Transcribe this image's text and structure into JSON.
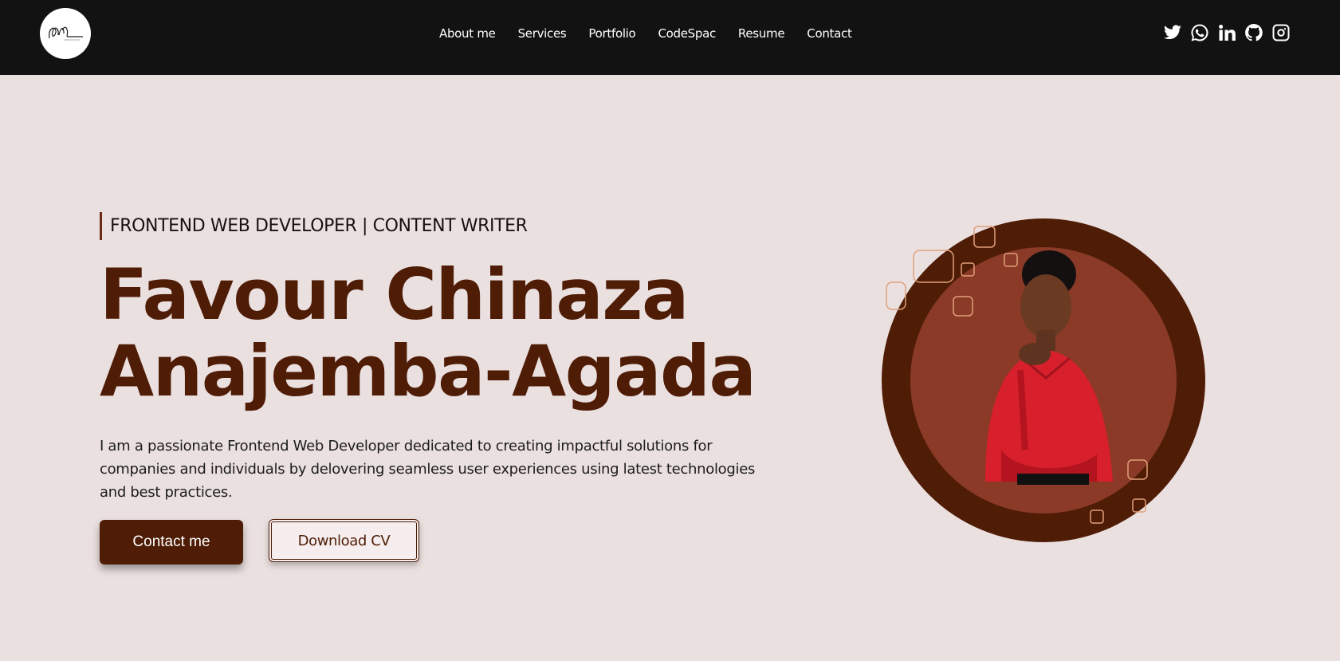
{
  "brand": {
    "logo_icon": "signature-logo"
  },
  "nav": {
    "links": [
      "About me",
      "Services",
      "Portfolio",
      "CodeSpac",
      "Resume",
      "Contact"
    ]
  },
  "socials": [
    "twitter-icon",
    "whatsapp-icon",
    "linkedin-icon",
    "github-icon",
    "instagram-icon"
  ],
  "hero": {
    "tagline": "FRONTEND WEB DEVELOPER | CONTENT WRITER",
    "name_line1": "Favour Chinaza",
    "name_line2": "Anajemba-Agada",
    "description": "I am a passionate Frontend Web Developer dedicated to creating impactful solutions for companies and individuals by delovering seamless user experiences using latest technologies and best practices.",
    "contact_button": "Contact me",
    "download_button": "Download CV"
  },
  "colors": {
    "navbar": "#121212",
    "background": "#ebe0e0",
    "accent": "#4f1c06",
    "portrait_inner": "#8a3a26"
  }
}
